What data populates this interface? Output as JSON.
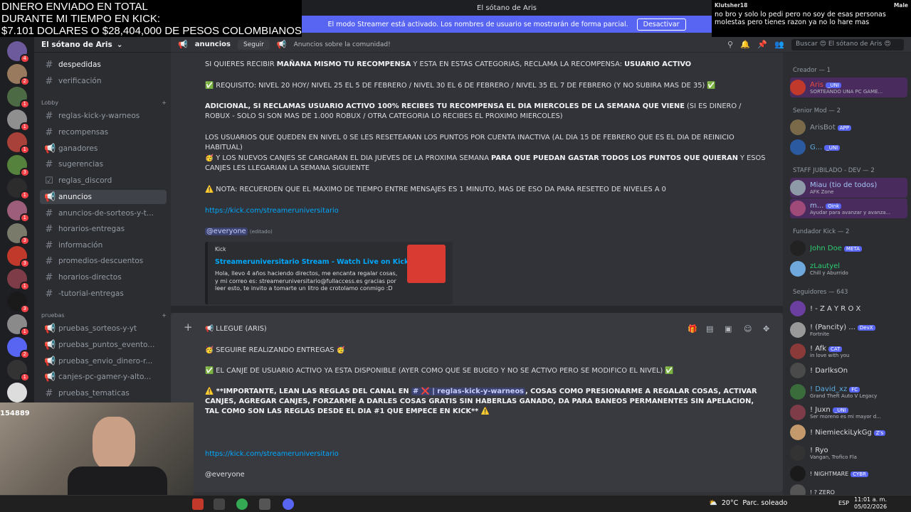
{
  "overlay": {
    "line1": "DINERO ENVIADO EN TOTAL",
    "line2": "DURANTE MI TIEMPO EN KICK:",
    "line3": "$7.101 DOLARES O $28,404,000 DE PESOS COLOMBIANOS"
  },
  "window": {
    "title": "El sótano de Aris"
  },
  "streamer_mode": {
    "text": "El modo Streamer está activado. Los nombres de usuario se mostrarán de forma parcial.",
    "button": "Desactivar"
  },
  "stream_chat": {
    "user": "Klutsher18",
    "tag": "Male",
    "message": "no bro y solo lo pedi pero no soy de esas personas molestas pero tienes razon ya no lo hare mas"
  },
  "server": {
    "name": "El sótano de Aris"
  },
  "channels": [
    {
      "name": "despedidas",
      "icon": "#"
    },
    {
      "name": "verificación",
      "icon": "#"
    },
    {
      "name": "reglas-kick-y-warneos",
      "icon": "#"
    },
    {
      "name": "recompensas",
      "icon": "#"
    },
    {
      "name": "ganadores",
      "icon": "📢"
    },
    {
      "name": "sugerencias",
      "icon": "#"
    },
    {
      "name": "reglas_discord",
      "icon": "☑"
    },
    {
      "name": "anuncios",
      "icon": "📢"
    },
    {
      "name": "anuncios-de-sorteos-y-t...",
      "icon": "#"
    },
    {
      "name": "horarios-entregas",
      "icon": "#"
    },
    {
      "name": "información",
      "icon": "#"
    },
    {
      "name": "promedios-descuentos",
      "icon": "#"
    },
    {
      "name": "horarios-directos",
      "icon": "#"
    },
    {
      "name": "-tutorial-entregas",
      "icon": "#"
    },
    {
      "name": "pruebas_sorteos-y-yt",
      "icon": "📢"
    },
    {
      "name": "pruebas_puntos_evento...",
      "icon": "📢"
    },
    {
      "name": "pruebas_envio_dinero-r...",
      "icon": "📢"
    },
    {
      "name": "canjes-pc-gamer-y-alto...",
      "icon": "📢"
    },
    {
      "name": "pruebas_tematicas",
      "icon": "#"
    }
  ],
  "categories": {
    "lobby": "Lobby",
    "pruebas": "pruebas"
  },
  "topbar": {
    "channel": "anuncios",
    "follow": "Seguir",
    "topic": "Anuncios sobre la comunidad!",
    "search_placeholder": "Buscar 😍 El sótano de Aris 😍"
  },
  "messages": {
    "m1_a": "SI QUIERES RECIBIR ",
    "m1_b": "MAÑANA MISMO TU RECOMPENSA",
    "m1_c": " Y ESTA EN ESTAS CATEGORIAS, RECLAMA LA RECOMPENSA: ",
    "m1_d": "USUARIO ACTIVO",
    "m2": "✅ REQUISITO: NIVEL 20 HOY/ NIVEL 25 EL 5 DE FEBRERO / NIVEL 30 EL 6 DE FEBRERO / NIVEL 35 EL 7 DE FEBRERO (Y NO SUBIRA MAS DE 35) ✅",
    "m3_a": "ADICIONAL, SI RECLAMAS USUARIO ACTIVO 100% RECIBES TU RECOMPENSA EL DIA MIERCOLES DE LA SEMANA QUE VIENE",
    "m3_b": " (SI ES DINERO / ROBUX - SOLO SI SON MAS DE 1.000 ROBUX / OTRA CATEGORIA LO RECIBES EL PROXIMO MIERCOLES)",
    "m4": "LOS USUARIOS QUE QUEDEN EN NIVEL 0 SE LES RESETEARAN LOS PUNTOS POR CUENTA INACTIVA (AL DIA 15 DE FEBRERO QUE ES EL DIA DE REINICIO HABITUAL)",
    "m5_a": "🥳 Y LOS NUEVOS CANJES SE CARGARAN EL DIA JUEVES DE LA PROXIMA SEMANA ",
    "m5_b": "PARA QUE PUEDAN GASTAR TODOS LOS PUNTOS QUE QUIERAN",
    "m5_c": " Y ESOS CANJES LES LLEGARIAN LA SEMANA SIGUIENTE",
    "m6": "⚠️ NOTA: RECUERDEN QUE EL MAXIMO DE TIEMPO ENTRE MENSAJES ES 1 MINUTO, MAS DE ESO DA PARA RESETEO DE NIVELES A 0",
    "link": "https://kick.com/streameruniversitario",
    "mention": "@everyone",
    "edited": "(editado)"
  },
  "embed": {
    "provider": "Kick",
    "title": "Streameruniversitario Stream - Watch Live on Kick",
    "description": "Hola, llevo 4 años haciendo directos, me encanta regalar cosas, y mi correo es: streameruniversitario@fullaccess.es gracias por leer esto, te invito a tomarte un litro de crotolamo conmigo :D"
  },
  "draft": {
    "line1": "📢 LLEGUE (ARIS)",
    "line2": "🥳 SEGUIRE REALIZANDO ENTREGAS 🥳",
    "line3": "✅ EL CANJE DE USUARIO ACTIVO YA ESTA DISPONIBLE (AYER COMO QUE SE BUGEO Y NO SE ACTIVO PERO SE MODIFICO EL NIVEL) ✅",
    "line4_a": "⚠️ **IMPORTANTE, LEAN LAS REGLAS DEL CANAL EN ",
    "line4_ch": "# ❌ | reglas-kick-y-warneos",
    "line4_b": ", COSAS COMO PRESIONARME A REGALAR COSAS, ACTIVAR CANJES, AGREGAR CANJES, FORZARME A DARLES COSAS GRATIS SIN HABERLAS GANADO, DA PARA BANEOS PERMANENTES SIN APELACION, TAL COMO SON LAS REGLAS DESDE EL DIA #1 QUE EMPECE EN KICK** ⚠️",
    "link": "https://kick.com/streameruniversitario",
    "mention": "@everyone"
  },
  "members": {
    "creador_head": "Creador — 1",
    "creador_1": {
      "name": "Aris",
      "tag": "_UNI",
      "status": "SORTEANDO UNA PC GAME..."
    },
    "senior_head": "Senior Mod — 2",
    "senior_1": {
      "name": "ArisBot",
      "tag": "APP"
    },
    "senior_2": {
      "name": "G...",
      "tag": "_UNI"
    },
    "staff_head": "STAFF JUBILADO - DEV — 2",
    "staff_1": {
      "name": "Miau (tio de todos)",
      "status": "AFK Zone"
    },
    "staff_2": {
      "name": "m...",
      "tag": "Oink",
      "status": "Ayudar para avanzar y avanza..."
    },
    "fundador_head": "Fundador Kick — 2",
    "fundador_1": {
      "name": "John Doe",
      "tag": "META"
    },
    "fundador_2": {
      "name": "zLautyel",
      "status": "Chill y Aburrido"
    },
    "seguidores_head": "Seguidores — 643",
    "seguidores": [
      {
        "name": "! - Z A Y R O X",
        "tag": "",
        "status": ""
      },
      {
        "name": "! (Pancity) ...",
        "tag": "DevX",
        "status": "Fortnite"
      },
      {
        "name": "! Afk",
        "tag": "CAT",
        "status": "in love with you"
      },
      {
        "name": "! DarlksOn",
        "tag": "",
        "status": ""
      },
      {
        "name": "! David_xz",
        "tag": "FC",
        "status": "Grand Theft Auto V Legacy"
      },
      {
        "name": "! Juxn",
        "tag": "_UNI",
        "status": "Ser moreno es mi mayor d..."
      },
      {
        "name": "! NiemieckiLykGg",
        "tag": "Z's",
        "status": ""
      },
      {
        "name": "! Ryo",
        "tag": "",
        "status": "Vangan, Trofico Fla"
      },
      {
        "name": "! NIGHTMARE",
        "tag": "CYBR",
        "status": ""
      },
      {
        "name": "! ? ZERO",
        "tag": "",
        "status": ""
      }
    ]
  },
  "webcam": {
    "label": "154889"
  },
  "taskbar": {
    "temp": "20°C",
    "weather": "Parc. soleado",
    "lang": "ESP",
    "time": "11:01 a. m.",
    "date": "05/02/2026"
  },
  "colors": {
    "accent": "#5865f2",
    "link": "#00a8fc",
    "background": "#313338",
    "sidebar": "#2b2d31"
  }
}
